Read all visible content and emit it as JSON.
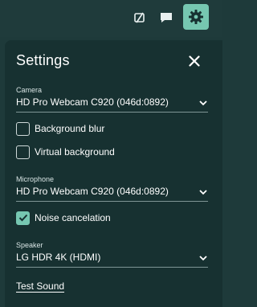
{
  "topbar": {
    "icons": [
      "video-off-icon",
      "chat-icon",
      "settings-gear-icon"
    ]
  },
  "panel": {
    "title": "Settings",
    "close_icon": "close-icon"
  },
  "camera": {
    "label": "Camera",
    "value": "HD Pro Webcam C920 (046d:0892)"
  },
  "options": {
    "background_blur": {
      "label": "Background blur",
      "checked": false
    },
    "virtual_background": {
      "label": "Virtual background",
      "checked": false
    },
    "noise_cancelation": {
      "label": "Noise cancelation",
      "checked": true
    }
  },
  "microphone": {
    "label": "Microphone",
    "value": "HD Pro Webcam C920 (046d:0892)"
  },
  "speaker": {
    "label": "Speaker",
    "value": "LG HDR 4K (HDMI)"
  },
  "test_sound": {
    "label": "Test Sound"
  },
  "colors": {
    "background": "#1e3a3a",
    "panel": "#173131",
    "accent": "#76c7b1"
  }
}
